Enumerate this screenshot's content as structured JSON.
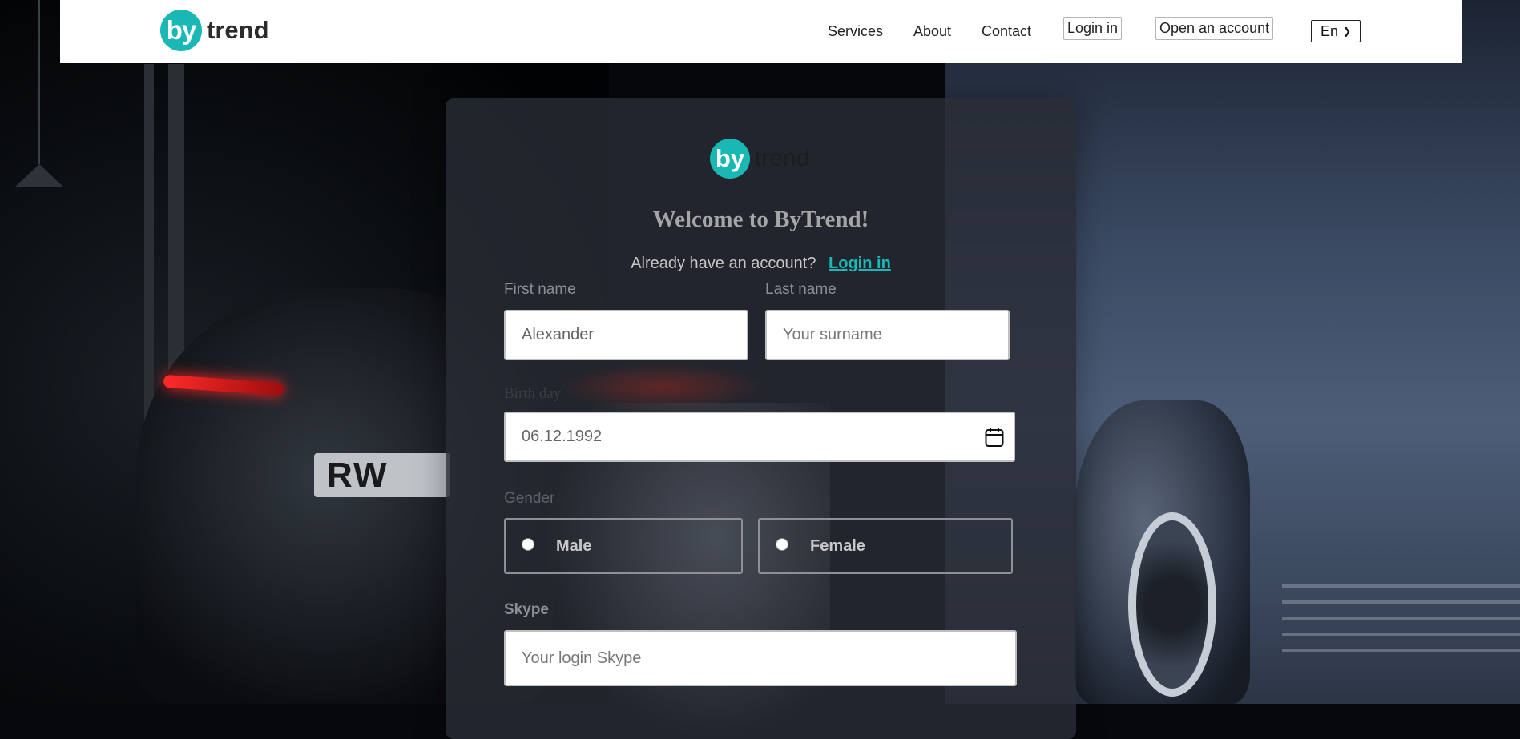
{
  "header": {
    "logo": {
      "mark": "by",
      "word": "trend"
    },
    "nav": {
      "services": "Services",
      "about": "About",
      "contact": "Contact"
    },
    "login_button": "Login in",
    "open_account_button": "Open an account",
    "language": {
      "selected": "En"
    }
  },
  "form": {
    "logo": {
      "mark": "by",
      "word": "trend"
    },
    "title": "Welcome to ByTrend!",
    "have_account_text": "Already have an account?",
    "login_link": "Login in",
    "first_name": {
      "label": "First name",
      "value": "Alexander"
    },
    "last_name": {
      "label": "Last name",
      "placeholder": "Your surname"
    },
    "birthday": {
      "label": "Birth day",
      "value": "06.12.1992",
      "icon": "calendar-icon"
    },
    "gender": {
      "label": "Gender",
      "options": [
        "Male",
        "Female"
      ]
    },
    "skype": {
      "label": "Skype",
      "placeholder": "Your login Skype"
    }
  },
  "colors": {
    "brand": "#19b8b5",
    "card": "#282c34"
  }
}
